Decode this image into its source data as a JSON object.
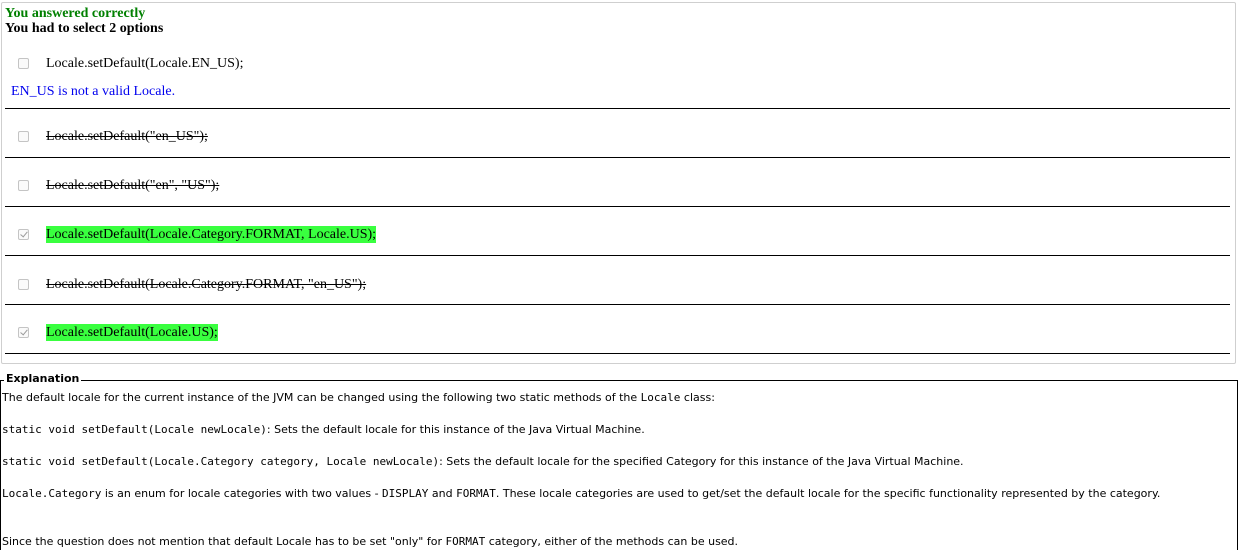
{
  "result": {
    "status": "You answered correctly",
    "instruction": "You had to select 2 options"
  },
  "options": [
    {
      "text": "Locale.setDefault(Locale.EN_US);",
      "checked": false,
      "state": "plain"
    },
    {
      "text": "Locale.setDefault(\"en_US\");",
      "checked": false,
      "state": "struck"
    },
    {
      "text": "Locale.setDefault(\"en\", \"US\"); ",
      "checked": false,
      "state": "struck"
    },
    {
      "text": "Locale.setDefault(Locale.Category.FORMAT, Locale.US);",
      "checked": true,
      "state": "correct"
    },
    {
      "text": "Locale.setDefault(Locale.Category.FORMAT, \"en_US\");",
      "checked": false,
      "state": "struck"
    },
    {
      "text": "Locale.setDefault(Locale.US);",
      "checked": true,
      "state": "correct"
    }
  ],
  "option_note": "EN_US is not a valid Locale.",
  "colors": {
    "correct_title": "#008000",
    "note": "#0000ee",
    "correct_highlight": "#39ff3f"
  },
  "explanation": {
    "legend": "Explanation",
    "p1_a": "The default locale for the current instance of the JVM can be changed using the following two static methods of the ",
    "p1_code": "Locale",
    "p1_b": " class:",
    "p2_code": "static void setDefault(Locale newLocale)",
    "p2_text": ": Sets the default locale for this instance of the Java Virtual Machine.",
    "p3_code": "static void setDefault(Locale.Category category, Locale newLocale)",
    "p3_text": ": Sets the default locale for the specified Category for this instance of the Java Virtual Machine.",
    "p4_code1": "Locale.Category",
    "p4_a": " is an enum for locale categories with two values - ",
    "p4_code2": "DISPLAY",
    "p4_b": " and ",
    "p4_code3": "FORMAT",
    "p4_c": ". These locale categories are used to get/set the default locale for the specific functionality represented by the category.",
    "p5_a": "Since the question does not mention that default Locale has to be set \"only\" for ",
    "p5_code": "FORMAT",
    "p5_b": " category, either of the methods can be used."
  }
}
